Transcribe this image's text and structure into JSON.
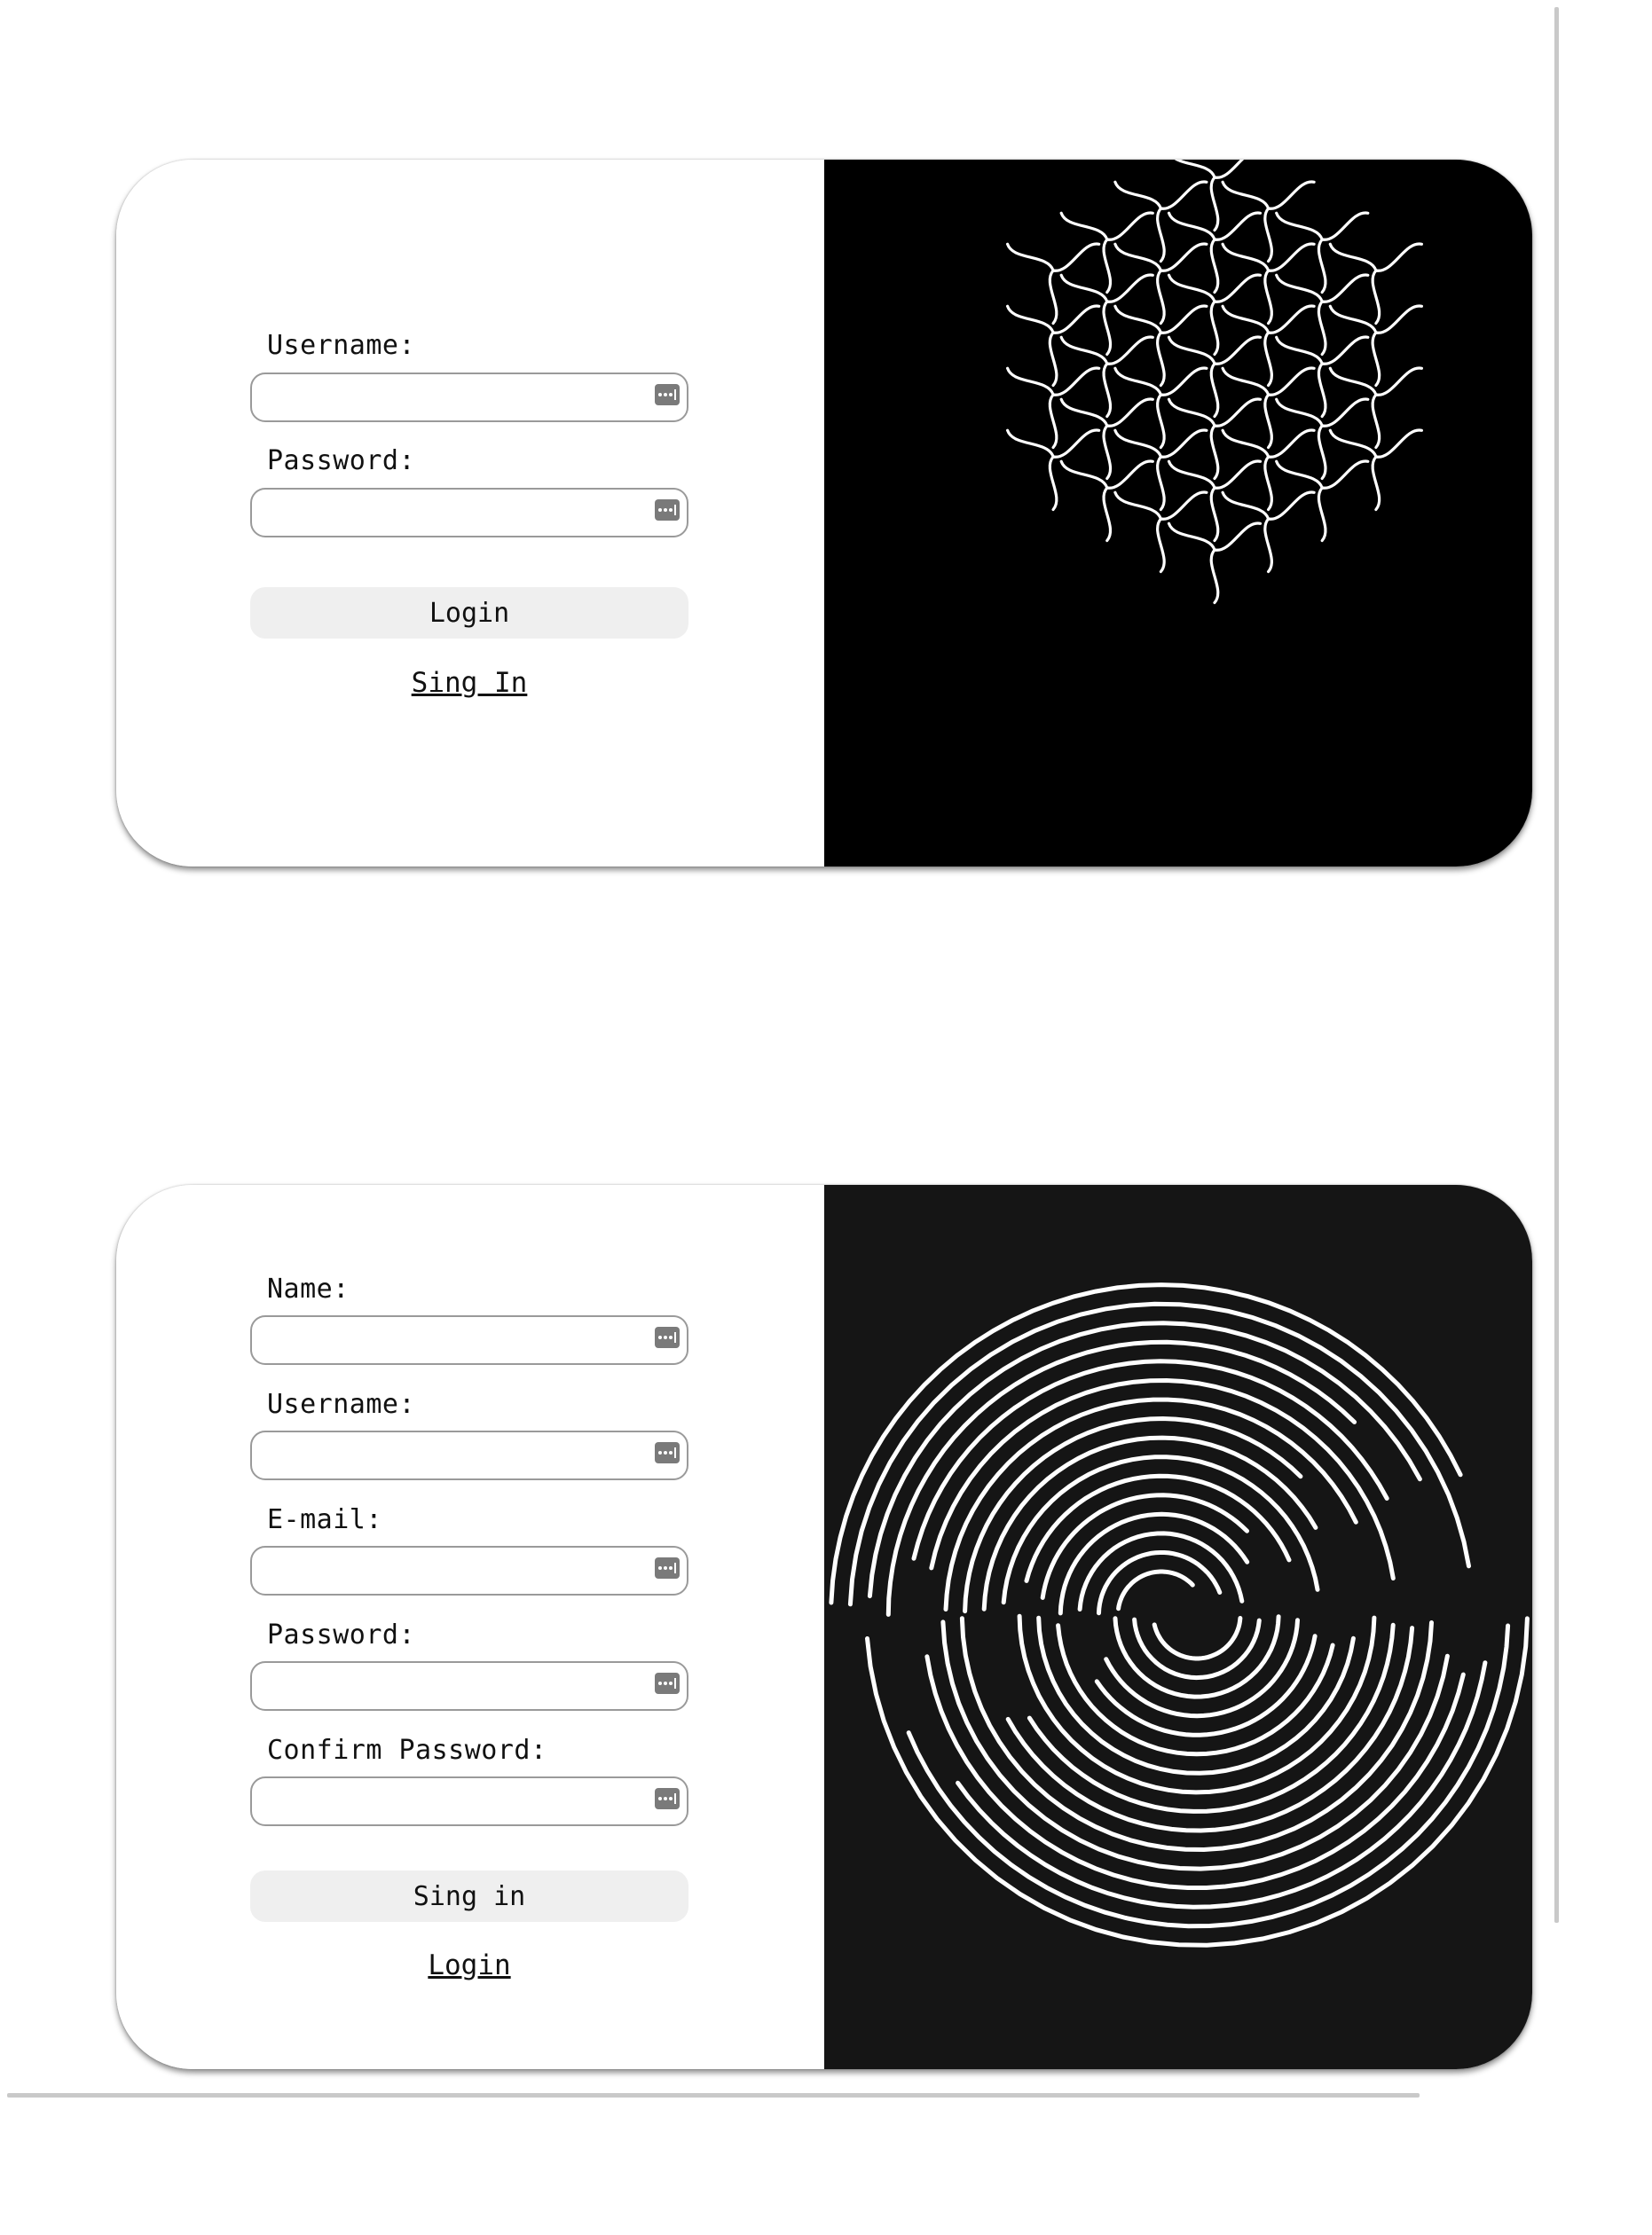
{
  "login_card": {
    "username_label": "Username:",
    "password_label": "Password:",
    "login_button": "Login",
    "signin_link": "Sing In"
  },
  "signup_card": {
    "name_label": "Name:",
    "username_label": "Username:",
    "email_label": "E-mail:",
    "password_label": "Password:",
    "confirm_password_label": "Confirm Password:",
    "signin_button": "Sing in",
    "login_link": "Login"
  },
  "icons": {
    "field_icon": "password-manager-key-icon",
    "login_art": "wavy-cube-art",
    "signup_art": "split-spiral-art"
  },
  "colors": {
    "art_background_login": "#000000",
    "art_background_signup": "#151515",
    "button_background": "#efefef",
    "input_border": "#9a9a9a"
  }
}
